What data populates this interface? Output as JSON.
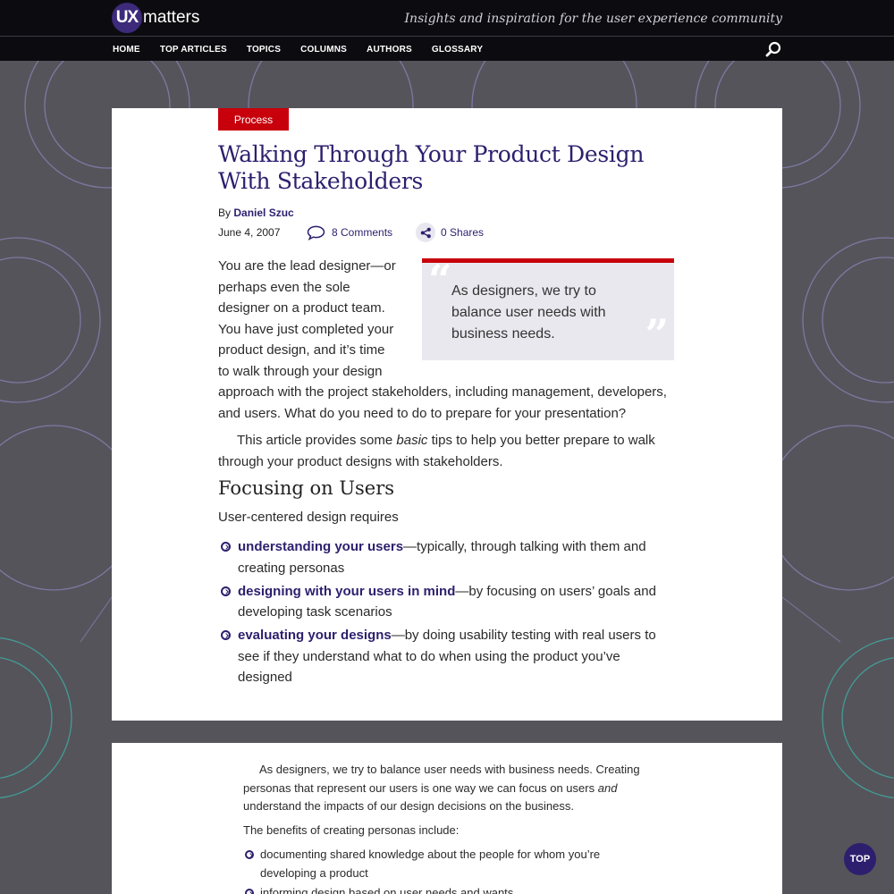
{
  "header": {
    "logo_badge": "UX",
    "logo_word": "matters",
    "tagline": "Insights and inspiration for the user experience community"
  },
  "nav": {
    "items": [
      "HOME",
      "TOP ARTICLES",
      "TOPICS",
      "COLUMNS",
      "AUTHORS",
      "GLOSSARY"
    ],
    "search_icon": "search-icon"
  },
  "article": {
    "category": "Process",
    "title": "Walking Through Your Product Design With Stakeholders",
    "byline_prefix": "By",
    "author": "Daniel Szuc",
    "date": "June 4, 2007",
    "comments": "8 Comments",
    "shares": "0 Shares",
    "para1": "You are the lead designer—or perhaps even the sole designer on a product team. You have just completed your product design, and it’s time to walk through your design approach with the project stakeholders, including management, developers, and users. What do you need to do to prepare for your presentation?",
    "pullquote": "As designers, we try to balance user needs with business needs.",
    "para2_before": "This article provides some",
    "para2_em": "basic",
    "para2_after": "tips to help you better prepare to walk through your product designs with stakeholders.",
    "section_heading": "Focusing on Users",
    "intro": "User-centered design requires",
    "bullets": [
      {
        "lead": "understanding your users",
        "rest": "—typically, through talking with them and creating personas"
      },
      {
        "lead": "designing with your users in mind",
        "rest": "—by focusing on users’ goals and developing task scenarios"
      },
      {
        "lead": "evaluating your designs",
        "rest": "—by doing usability testing with real users to see if they understand what to do when using the product you’ve designed"
      }
    ]
  },
  "second": {
    "para_before": "As designers, we try to balance user needs with business needs. Creating personas that represent our users is one way we can focus on users",
    "para_em": "and",
    "para_after": "understand the impacts of our design decisions on the business.",
    "benefits_intro": "The benefits of creating personas include:",
    "bullets": [
      "documenting shared knowledge about the people for whom you’re developing a product",
      "informing design based on user needs and wants"
    ]
  },
  "top_button": "TOP",
  "colors": {
    "brand_purple": "#2d1f6e",
    "category_red": "#c8000b",
    "background": "#55545b"
  }
}
